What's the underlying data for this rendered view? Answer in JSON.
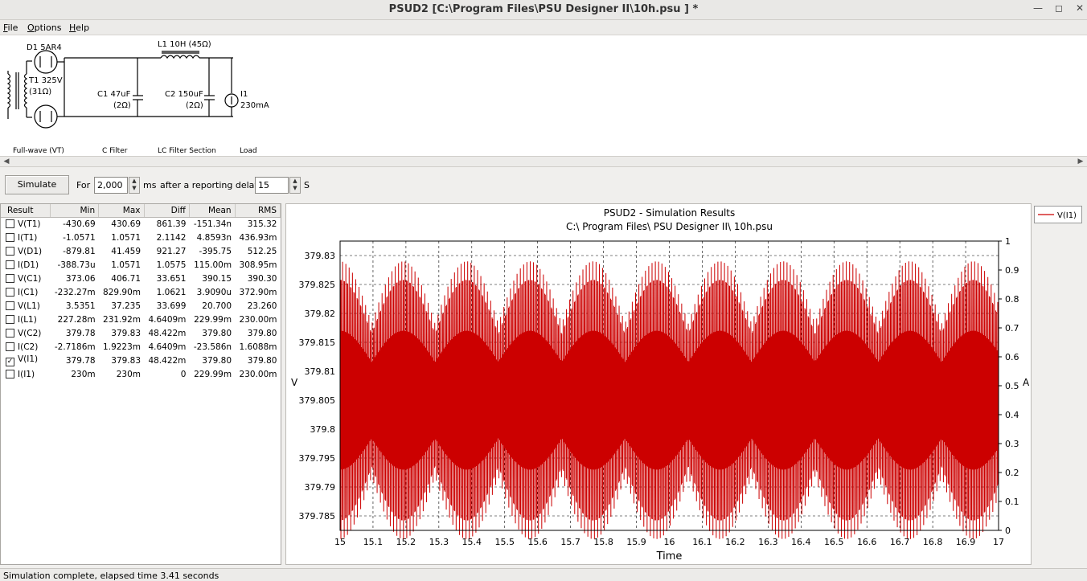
{
  "window": {
    "title": "PSUD2  [C:\\Program Files\\PSU Designer II\\10h.psu ] *"
  },
  "menu": [
    {
      "key": "F",
      "rest": "ile"
    },
    {
      "key": "O",
      "rest": "ptions"
    },
    {
      "key": "H",
      "rest": "elp"
    }
  ],
  "schematic": {
    "d1": "D1 5AR4",
    "t1": "T1 325V",
    "t1_r": "(31Ω)",
    "l1": "L1 10H (45Ω)",
    "c1": "C1 47uF",
    "c1_r": "(2Ω)",
    "c2": "C2 150uF",
    "c2_r": "(2Ω)",
    "i1": "I1",
    "i1_v": "230mA",
    "sec_fullwave": "Full-wave (VT)",
    "sec_cfilter": "C Filter",
    "sec_lc": "LC Filter Section",
    "sec_load": "Load"
  },
  "controls": {
    "simulate": "Simulate",
    "for": "For",
    "duration": "2,000",
    "ms": "ms",
    "after": "after a reporting delay of",
    "delay": "15",
    "s": "S"
  },
  "results": {
    "headers": [
      "Result",
      "Min",
      "Max",
      "Diff",
      "Mean",
      "RMS"
    ],
    "rows": [
      {
        "checked": false,
        "cells": [
          "V(T1)",
          "-430.69",
          "430.69",
          "861.39",
          "-151.34n",
          "315.32"
        ]
      },
      {
        "checked": false,
        "cells": [
          "I(T1)",
          "-1.0571",
          "1.0571",
          "2.1142",
          "4.8593n",
          "436.93m"
        ]
      },
      {
        "checked": false,
        "cells": [
          "V(D1)",
          "-879.81",
          "41.459",
          "921.27",
          "-395.75",
          "512.25"
        ]
      },
      {
        "checked": false,
        "cells": [
          "I(D1)",
          "-388.73u",
          "1.0571",
          "1.0575",
          "115.00m",
          "308.95m"
        ]
      },
      {
        "checked": false,
        "cells": [
          "V(C1)",
          "373.06",
          "406.71",
          "33.651",
          "390.15",
          "390.30"
        ]
      },
      {
        "checked": false,
        "cells": [
          "I(C1)",
          "-232.27m",
          "829.90m",
          "1.0621",
          "3.9090u",
          "372.90m"
        ]
      },
      {
        "checked": false,
        "cells": [
          "V(L1)",
          "3.5351",
          "37.235",
          "33.699",
          "20.700",
          "23.260"
        ]
      },
      {
        "checked": false,
        "cells": [
          "I(L1)",
          "227.28m",
          "231.92m",
          "4.6409m",
          "229.99m",
          "230.00m"
        ]
      },
      {
        "checked": false,
        "cells": [
          "V(C2)",
          "379.78",
          "379.83",
          "48.422m",
          "379.80",
          "379.80"
        ]
      },
      {
        "checked": false,
        "cells": [
          "I(C2)",
          "-2.7186m",
          "1.9223m",
          "4.6409m",
          "-23.586n",
          "1.6088m"
        ]
      },
      {
        "checked": true,
        "cells": [
          "V(I1)",
          "379.78",
          "379.83",
          "48.422m",
          "379.80",
          "379.80"
        ]
      },
      {
        "checked": false,
        "cells": [
          "I(I1)",
          "230m",
          "230m",
          "0",
          "229.99m",
          "230.00m"
        ]
      }
    ]
  },
  "chart_data": {
    "type": "line",
    "title": "PSUD2 - Simulation Results",
    "subtitle": "C:\\ Program Files\\ PSU Designer II\\ 10h.psu",
    "xlabel": "Time",
    "ylabel": "V",
    "y2label": "A",
    "xlim": [
      15,
      17
    ],
    "ylim": [
      379.7825,
      379.8325
    ],
    "y2lim": [
      0,
      1
    ],
    "xticks": [
      "15",
      "15.1",
      "15.2",
      "15.3",
      "15.4",
      "15.5",
      "15.6",
      "15.7",
      "15.8",
      "15.9",
      "16",
      "16.1",
      "16.2",
      "16.3",
      "16.4",
      "16.5",
      "16.6",
      "16.7",
      "16.8",
      "16.9",
      "17"
    ],
    "yticks": [
      "379.83",
      "379.825",
      "379.82",
      "379.815",
      "379.81",
      "379.805",
      "379.8",
      "379.795",
      "379.79",
      "379.785"
    ],
    "y2ticks": [
      "1",
      "0.9",
      "0.8",
      "0.7",
      "0.6",
      "0.5",
      "0.4",
      "0.3",
      "0.2",
      "0.1",
      "0"
    ],
    "grid": true,
    "legend": "right",
    "series": [
      {
        "name": "V(I1)",
        "color": "#cc0000",
        "ripple_frequency_hz": 100,
        "mean": 379.805,
        "amplitude": 0.024
      }
    ]
  },
  "status": "Simulation complete, elapsed time 3.41 seconds"
}
